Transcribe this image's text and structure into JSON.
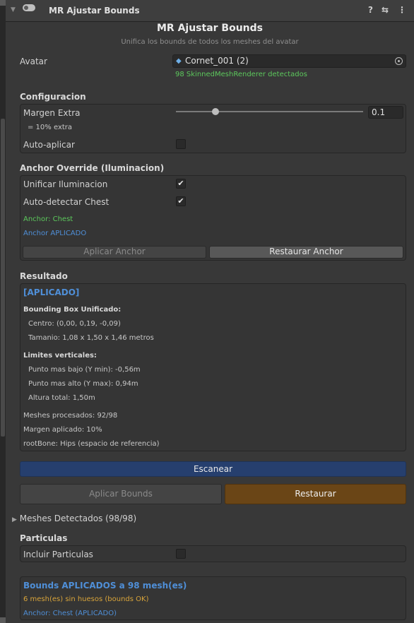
{
  "header": {
    "component_title": "MR Ajustar Bounds",
    "help_icon": "help-icon",
    "settings_icon": "sliders-icon",
    "menu_icon": "kebab-menu-icon"
  },
  "intro": {
    "title": "MR Ajustar Bounds",
    "subtitle": "Unifica los bounds de todos los meshes del avatar"
  },
  "avatar": {
    "label": "Avatar",
    "value": "Cornet_001 (2)",
    "status": "98 SkinnedMeshRenderer detectados"
  },
  "configuracion": {
    "title": "Configuracion",
    "margin_label": "Margen Extra",
    "margin_value": "0.1",
    "margin_level": 0.1,
    "margin_note": "= 10% extra",
    "auto_label": "Auto-aplicar",
    "auto_checked": false
  },
  "anchor": {
    "title": "Anchor Override (Iluminacion)",
    "unify_label": "Unificar Iluminacion",
    "unify_checked": true,
    "auto_label": "Auto-detectar Chest",
    "auto_checked": true,
    "anchor_line": "Anchor: Chest",
    "status_line": "Anchor APLICADO",
    "apply_button": "Aplicar Anchor",
    "restore_button": "Restaurar Anchor"
  },
  "result": {
    "title": "Resultado",
    "status": "[APLICADO]",
    "bbox_heading": "Bounding Box Unificado:",
    "center": "Centro: (0,00, 0,19, -0,09)",
    "size": "Tamanio: 1,08 x 1,50 x 1,46 metros",
    "limits_heading": "Limites verticales:",
    "min": "Punto mas bajo (Y min): -0,56m",
    "max": "Punto mas alto (Y max): 0,94m",
    "height": "Altura total: 1,50m",
    "meshes": "Meshes procesados: 92/98",
    "margin": "Margen aplicado: 10%",
    "rootbone": "rootBone: Hips (espacio de referencia)"
  },
  "actions": {
    "scan": "Escanear",
    "apply_bounds": "Aplicar Bounds",
    "restore": "Restaurar"
  },
  "meshes_foldout": "Meshes Detectados (98/98)",
  "particles": {
    "title": "Particulas",
    "include_label": "Incluir Particulas",
    "include_checked": false
  },
  "summary": {
    "line1": "Bounds APLICADOS a 98 mesh(es)",
    "line2": "6 mesh(es) sin huesos (bounds OK)",
    "line3": "Anchor: Chest (APLICADO)"
  },
  "colors": {
    "accent_blue": "#4f8fd8",
    "success_green": "#5cc85c",
    "warning_orange": "#d8a43a",
    "scan_button": "#263f6e",
    "restore_button": "#6a4516"
  }
}
